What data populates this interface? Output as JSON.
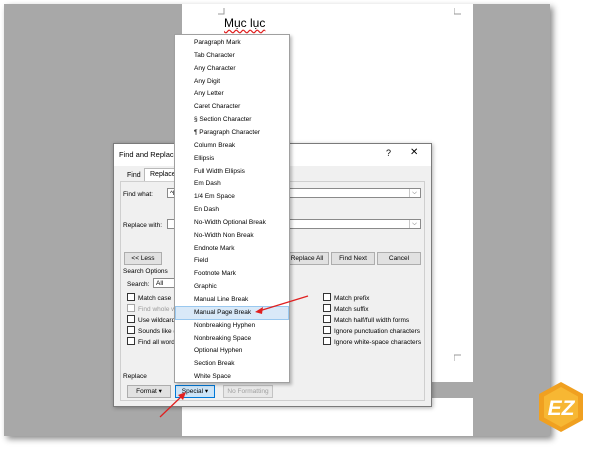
{
  "document": {
    "heading": "Mục lục"
  },
  "dialog": {
    "title": "Find and Replace",
    "help": "?",
    "close": "✕",
    "tabs": [
      "Find",
      "Replace"
    ],
    "find_what_label": "Find what:",
    "find_what_value": "^b",
    "replace_with_label": "Replace with:",
    "less_button": "<< Less",
    "replace_all_button": "Replace All",
    "find_next_button": "Find Next",
    "cancel_button": "Cancel",
    "search_options_label": "Search Options",
    "search_label": "Search:",
    "search_value": "All",
    "options_left": [
      "Match case",
      "Find whole w",
      "Use wildcard",
      "Sounds like (",
      "Find all word"
    ],
    "options_right": [
      "Match prefix",
      "Match suffix",
      "Match half/full width forms",
      "Ignore punctuation characters",
      "Ignore white-space characters"
    ],
    "replace_section_label": "Replace",
    "format_button": "Format ▾",
    "special_button": "Special ▾",
    "no_formatting_button": "No Formatting"
  },
  "special_menu": {
    "items": [
      "Paragraph Mark",
      "Tab Character",
      "Any Character",
      "Any Digit",
      "Any Letter",
      "Caret Character",
      "§ Section Character",
      "¶ Paragraph Character",
      "Column Break",
      "Ellipsis",
      "Full Width Ellipsis",
      "Em Dash",
      "1/4 Em Space",
      "En Dash",
      "No-Width Optional Break",
      "No-Width Non Break",
      "Endnote Mark",
      "Field",
      "Footnote Mark",
      "Graphic",
      "Manual Line Break",
      "Manual Page Break",
      "Nonbreaking Hyphen",
      "Nonbreaking Space",
      "Optional Hyphen",
      "Section Break",
      "White Space"
    ],
    "highlighted": "Manual Page Break"
  },
  "logo": {
    "text": "EZ",
    "color": "#f0a020"
  },
  "annotation_color": "#e02020"
}
